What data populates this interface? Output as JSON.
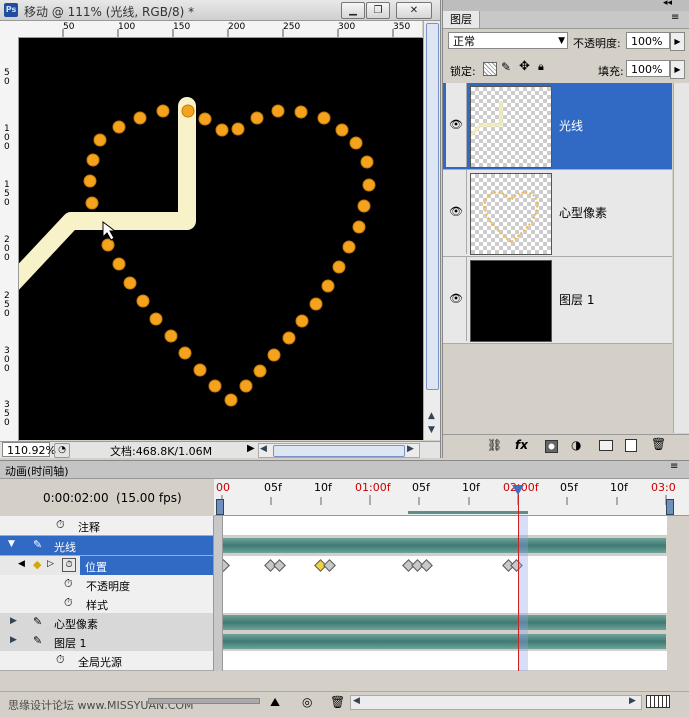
{
  "document": {
    "title": "移动 @ 111% (光线, RGB/8) *",
    "app_logo": "Ps",
    "window_buttons": [
      "minimize-button",
      "restore-button",
      "close-button"
    ],
    "ruler_top_labels": [
      "50",
      "100",
      "150",
      "200",
      "250",
      "300",
      "350"
    ],
    "ruler_left_labels": [
      "5\n0",
      "1\n0\n0",
      "1\n5\n0",
      "2\n0\n0",
      "2\n5\n0",
      "3\n0\n0",
      "3\n5\n0"
    ],
    "zoom": "110.92%",
    "doc_size": "文档:468.8K/1.06M"
  },
  "layers_panel": {
    "tab_label": "图层",
    "blend_mode": "正常",
    "opacity_label": "不透明度:",
    "opacity_value": "100%",
    "lock_label": "锁定:",
    "fill_label": "填充:",
    "fill_value": "100%",
    "layers": [
      {
        "name": "光线",
        "selected": true
      },
      {
        "name": "心型像素",
        "selected": false
      },
      {
        "name": "图层 1",
        "selected": false
      }
    ],
    "footer_icons": [
      "link-icon",
      "fx-icon",
      "mask-icon",
      "adjustment-icon",
      "folder-icon",
      "new-layer-icon",
      "trash-icon"
    ]
  },
  "animation_panel": {
    "tab_label": "动画(时间轴)",
    "current_time": "0:00:02:00",
    "fps": "(15.00 fps)",
    "ruler_labels": [
      "00",
      "05f",
      "10f",
      "01:00f",
      "05f",
      "10f",
      "02:00f",
      "05f",
      "10f",
      "03:0"
    ],
    "tracks": [
      {
        "label": "注释",
        "type": "property"
      },
      {
        "label": "光线",
        "type": "layer",
        "selected": true
      },
      {
        "label": "位置",
        "type": "property",
        "selected": true
      },
      {
        "label": "不透明度",
        "type": "property"
      },
      {
        "label": "样式",
        "type": "property"
      },
      {
        "label": "心型像素",
        "type": "layer"
      },
      {
        "label": "图层 1",
        "type": "layer"
      },
      {
        "label": "全局光源",
        "type": "property"
      }
    ],
    "watermark": "思缘设计论坛 www.MISSYUAN.COM"
  },
  "colors": {
    "selection": "#316ac5",
    "dot_orange": "#f5a21c",
    "line_cream": "#f7f2c8",
    "timeline_bar": "#4f8a82",
    "playhead": "#cc2222"
  }
}
